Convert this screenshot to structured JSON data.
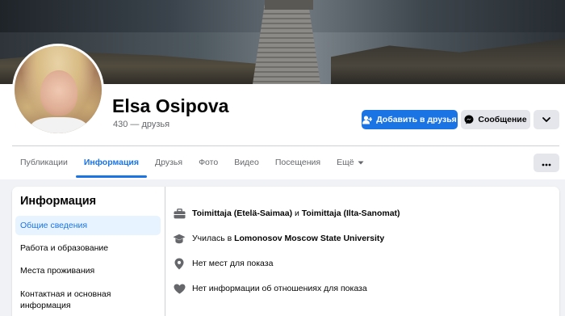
{
  "profile": {
    "name": "Elsa Osipova",
    "friends_count": "430 — друзья"
  },
  "actions": {
    "add_friend": "Добавить в друзья",
    "message": "Сообщение"
  },
  "tabs": [
    {
      "label": "Публикации",
      "active": false
    },
    {
      "label": "Информация",
      "active": true
    },
    {
      "label": "Друзья",
      "active": false
    },
    {
      "label": "Фото",
      "active": false
    },
    {
      "label": "Видео",
      "active": false
    },
    {
      "label": "Посещения",
      "active": false
    },
    {
      "label": "Ещё",
      "active": false
    }
  ],
  "about": {
    "title": "Информация",
    "sidebar": [
      {
        "label": "Общие сведения",
        "active": true
      },
      {
        "label": "Работа и образование",
        "active": false
      },
      {
        "label": "Места проживания",
        "active": false
      },
      {
        "label": "Контактная и основная информация",
        "active": false
      }
    ],
    "rows": {
      "work": {
        "job1": "Toimittaja (Etelä-Saimaa)",
        "connector": " и ",
        "job2": "Toimittaja (Ilta-Sanomat)",
        "icon": "briefcase-icon"
      },
      "education": {
        "prefix": "Училась в ",
        "school": "Lomonosov Moscow State University",
        "icon": "graduation-cap-icon"
      },
      "places": {
        "text": "Нет мест для показа",
        "icon": "location-pin-icon"
      },
      "relationship": {
        "text": "Нет информации об отношениях для показа",
        "icon": "heart-icon"
      }
    }
  },
  "colors": {
    "accent": "#1b74e4",
    "secondary_button": "#e4e6eb",
    "muted_text": "#65676b",
    "page_bg": "#f0f2f5"
  }
}
